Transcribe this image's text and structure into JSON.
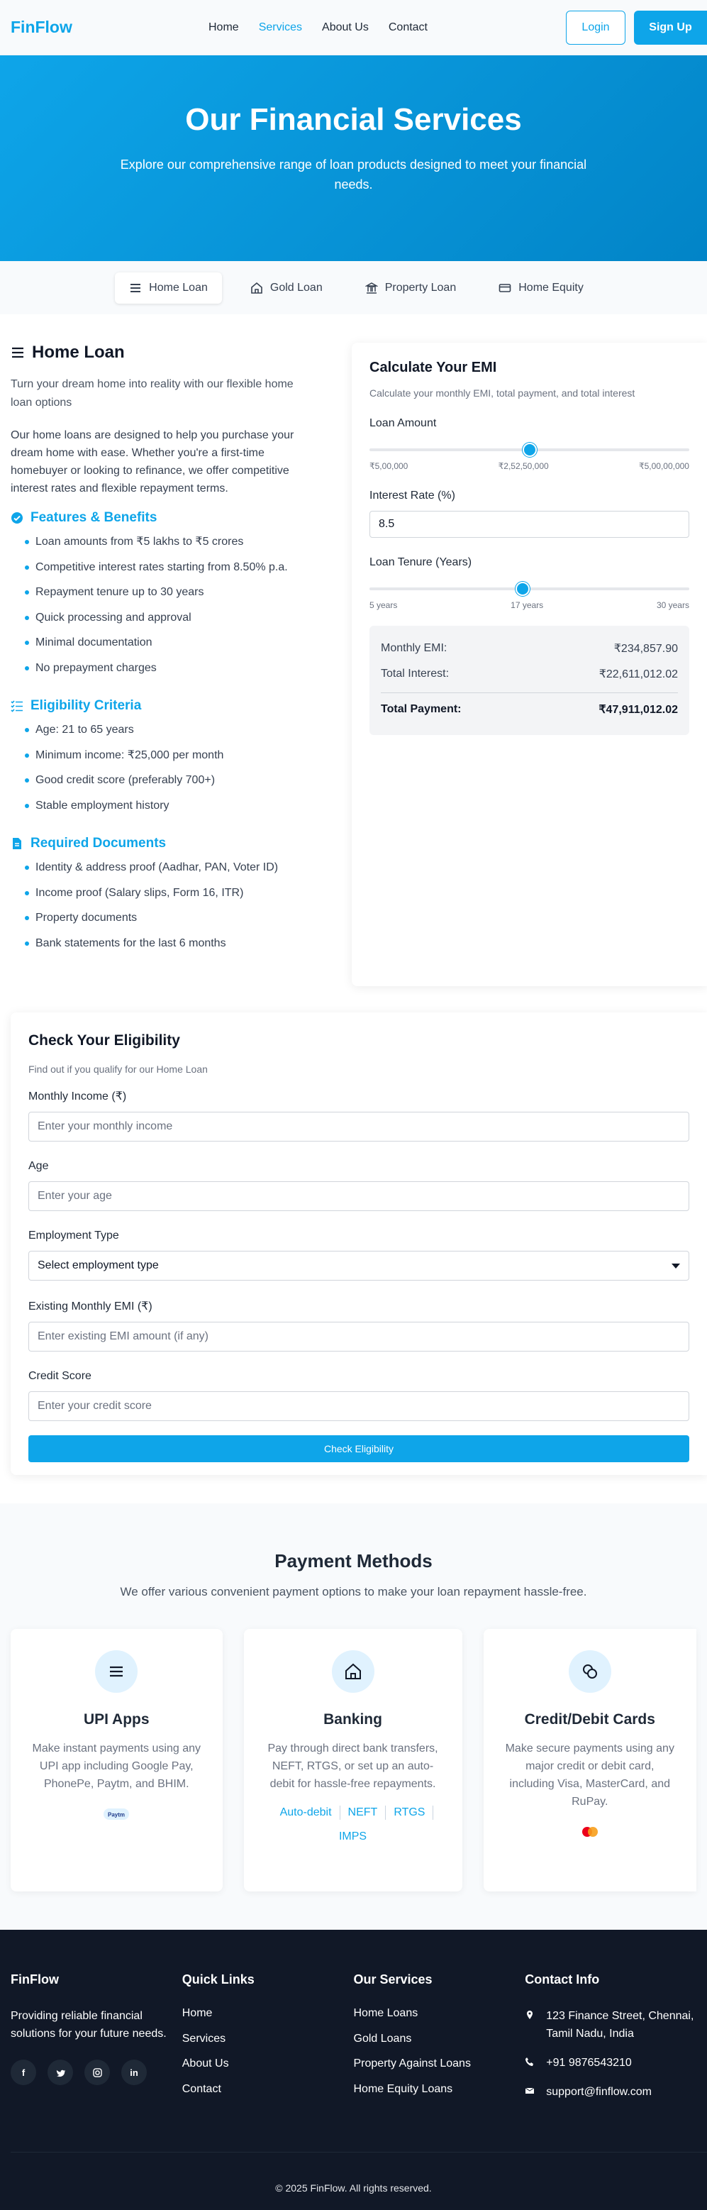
{
  "nav": {
    "brand": "FinFlow",
    "links": [
      "Home",
      "Services",
      "About Us",
      "Contact"
    ],
    "login": "Login",
    "signup": "Sign Up"
  },
  "hero": {
    "title": "Our Financial Services",
    "subtitle": "Explore our comprehensive range of loan products designed to meet your financial needs."
  },
  "tabs": [
    {
      "label": "Home Loan",
      "icon": "menu-icon",
      "active": true
    },
    {
      "label": "Gold Loan",
      "icon": "home-icon",
      "active": false
    },
    {
      "label": "Property Loan",
      "icon": "bank-icon",
      "active": false
    },
    {
      "label": "Home Equity",
      "icon": "card-icon",
      "active": false
    }
  ],
  "loan": {
    "title": "Home Loan",
    "subtitle": "Turn your dream home into reality with our flexible home loan options",
    "description": "Our home loans are designed to help you purchase your dream home with ease. Whether you're a first-time homebuyer or looking to refinance, we offer competitive interest rates and flexible repayment terms.",
    "features_heading": "Features & Benefits",
    "features": [
      "Loan amounts from ₹5 lakhs to ₹5 crores",
      "Competitive interest rates starting from 8.50% p.a.",
      "Repayment tenure up to 30 years",
      "Quick processing and approval",
      "Minimal documentation",
      "No prepayment charges"
    ],
    "eligibility_heading": "Eligibility Criteria",
    "eligibility": [
      "Age: 21 to 65 years",
      "Minimum income: ₹25,000 per month",
      "Good credit score (preferably 700+)",
      "Stable employment history"
    ],
    "documents_heading": "Required Documents",
    "documents": [
      "Identity & address proof (Aadhar, PAN, Voter ID)",
      "Income proof (Salary slips, Form 16, ITR)",
      "Property documents",
      "Bank statements for the last 6 months"
    ]
  },
  "emi": {
    "title": "Calculate Your EMI",
    "hint": "Calculate your monthly EMI, total payment, and total interest",
    "amount_label": "Loan Amount",
    "amount_min": "₹5,00,000",
    "amount_mid": "₹2,52,50,000",
    "amount_max": "₹5,00,00,000",
    "amount_fraction": 0.5,
    "rate_label": "Interest Rate (%)",
    "rate_value": "8.5",
    "tenure_label": "Loan Tenure (Years)",
    "tenure_min": "5 years",
    "tenure_mid": "17 years",
    "tenure_max": "30 years",
    "tenure_fraction": 0.48,
    "monthly_label": "Monthly EMI:",
    "monthly_value": "₹234,857.90",
    "interest_label": "Total Interest:",
    "interest_value": "₹22,611,012.02",
    "total_label": "Total Payment:",
    "total_value": "₹47,911,012.02"
  },
  "eligibility_form": {
    "title": "Check Your Eligibility",
    "hint": "Find out if you qualify for our Home Loan",
    "income_label": "Monthly Income (₹)",
    "income_placeholder": "Enter your monthly income",
    "age_label": "Age",
    "age_placeholder": "Enter your age",
    "employment_label": "Employment Type",
    "employment_value": "Select employment type",
    "existing_emi_label": "Existing Monthly EMI (₹)",
    "existing_emi_placeholder": "Enter existing EMI amount (if any)",
    "credit_label": "Credit Score",
    "credit_placeholder": "Enter your credit score",
    "submit": "Check Eligibility"
  },
  "payment": {
    "title": "Payment Methods",
    "subtitle": "We offer various convenient payment options to make your loan repayment hassle-free.",
    "cards": [
      {
        "title": "UPI Apps",
        "text": "Make instant payments using any UPI app including Google Pay, PhonePe, Paytm, and BHIM.",
        "icon": "menu-icon"
      },
      {
        "title": "Banking",
        "text": "Pay through direct bank transfers, NEFT, RTGS, or set up an auto-debit for hassle-free repayments.",
        "icon": "home-icon"
      },
      {
        "title": "Credit/Debit Cards",
        "text": "Make secure payments using any major credit or debit card, including Visa, MasterCard, and RuPay.",
        "icon": "coins-icon"
      }
    ],
    "bank_links": [
      "Auto-debit",
      "NEFT",
      "RTGS",
      "IMPS"
    ],
    "upi_logo": "Paytm"
  },
  "footer": {
    "brand": "FinFlow",
    "tagline": "Providing reliable financial solutions for your future needs.",
    "quick_heading": "Quick Links",
    "quick_links": [
      "Home",
      "Services",
      "About Us",
      "Contact"
    ],
    "services_heading": "Our Services",
    "services": [
      "Home Loans",
      "Gold Loans",
      "Property Against Loans",
      "Home Equity Loans"
    ],
    "contact_heading": "Contact Info",
    "address": "123 Finance Street, Chennai, Tamil Nadu, India",
    "phone": "+91 9876543210",
    "email": "support@finflow.com",
    "socials": [
      "facebook-icon",
      "twitter-icon",
      "instagram-icon",
      "linkedin-icon"
    ],
    "copyright": "© 2025 FinFlow. All rights reserved."
  }
}
